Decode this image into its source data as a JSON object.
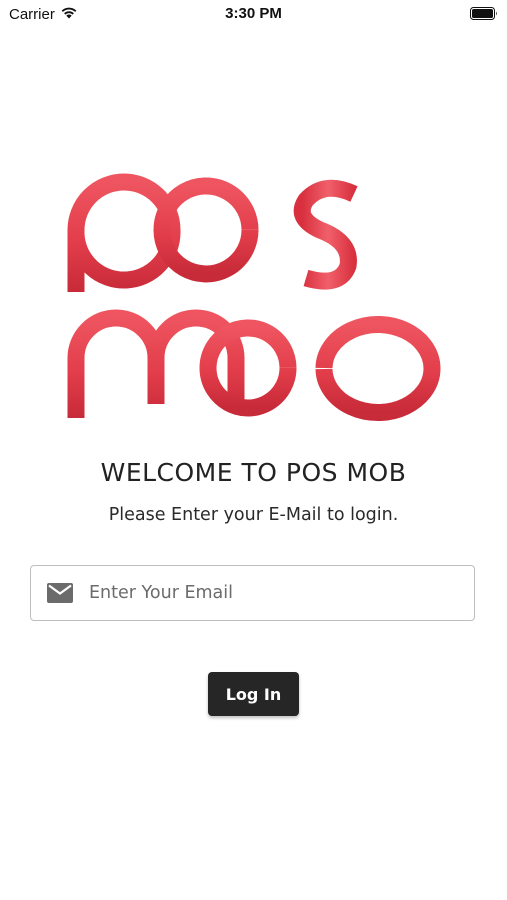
{
  "status_bar": {
    "carrier": "Carrier",
    "time": "3:30 PM",
    "icons": [
      "wifi-icon",
      "battery-icon"
    ]
  },
  "logo": {
    "brand": "pos mob",
    "color": "#e8434f"
  },
  "welcome": {
    "title": "WELCOME TO POS MOB",
    "subtitle": "Please Enter your E-Mail to login."
  },
  "email": {
    "icon": "mail-icon",
    "placeholder": "Enter Your Email",
    "value": ""
  },
  "login": {
    "label": "Log In",
    "background": "#262626"
  }
}
